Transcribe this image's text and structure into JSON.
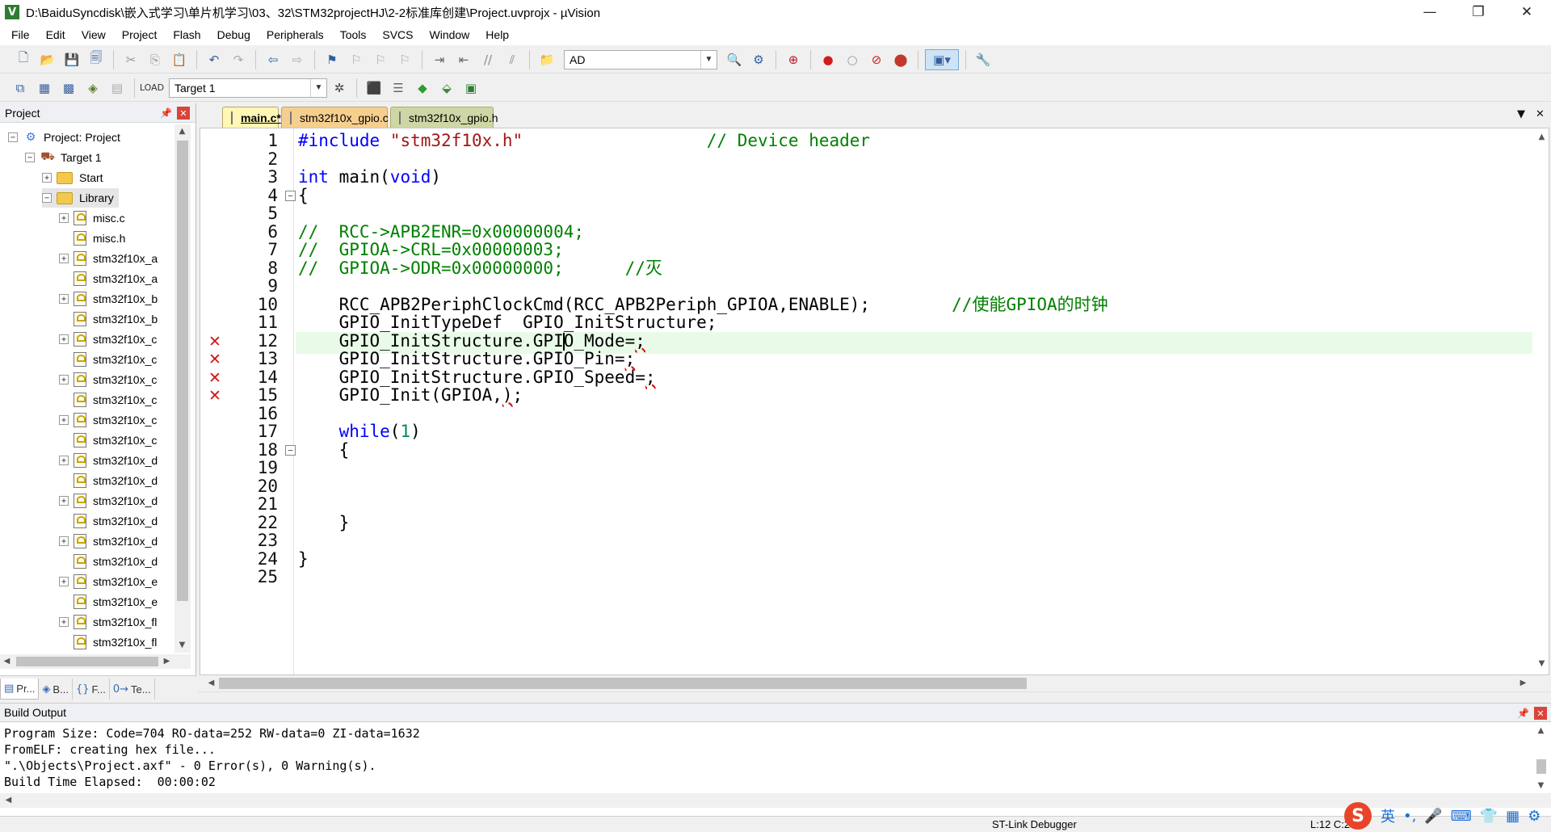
{
  "window": {
    "title": "D:\\BaiduSyncdisk\\嵌入式学习\\单片机学习\\03、32\\STM32projectHJ\\2-2标准库创建\\Project.uvprojx - µVision",
    "app_icon": "V",
    "controls": {
      "minimize": "—",
      "restore": "❐",
      "close": "✕"
    }
  },
  "menu": [
    "File",
    "Edit",
    "View",
    "Project",
    "Flash",
    "Debug",
    "Peripherals",
    "Tools",
    "SVCS",
    "Window",
    "Help"
  ],
  "toolbar1": {
    "find_combo_value": "AD",
    "icons": [
      "new-file-icon",
      "open-icon",
      "save-icon",
      "save-all-icon",
      "cut-icon",
      "copy-icon",
      "paste-icon",
      "undo-icon",
      "redo-icon",
      "nav-back-icon",
      "nav-forward-icon",
      "bookmark-icon",
      "prev-bookmark-icon",
      "next-bookmark-icon",
      "clear-bookmarks-icon",
      "indent-icon",
      "unindent-icon",
      "comment-icon",
      "uncomment-icon",
      "find-in-files-icon",
      "find-icon",
      "incremental-find-icon",
      "debug-start-icon",
      "breakpoint-insert-icon",
      "breakpoint-enable-icon",
      "breakpoint-disable-icon",
      "breakpoint-kill-icon",
      "window-layout-icon",
      "configure-icon"
    ]
  },
  "toolbar2": {
    "target_combo_value": "Target 1",
    "icons": [
      "translate-icon",
      "build-icon",
      "rebuild-icon",
      "batch-build-icon",
      "stop-build-icon",
      "download-icon",
      "target-options-icon",
      "manage-components-icon",
      "select-packs-icon",
      "pack-installer-icon",
      "software-packs-icon"
    ]
  },
  "project_panel": {
    "title": "Project",
    "tree": [
      {
        "label": "Project: Project",
        "level": 0,
        "expander": "−",
        "icon": "project"
      },
      {
        "label": "Target 1",
        "level": 1,
        "expander": "−",
        "icon": "target"
      },
      {
        "label": "Start",
        "level": 2,
        "expander": "+",
        "icon": "folder"
      },
      {
        "label": "Library",
        "level": 2,
        "expander": "−",
        "icon": "folder",
        "selected": true
      },
      {
        "label": "misc.c",
        "level": 3,
        "expander": "+",
        "icon": "file"
      },
      {
        "label": "misc.h",
        "level": 3,
        "expander": "",
        "icon": "file"
      },
      {
        "label": "stm32f10x_a",
        "level": 3,
        "expander": "+",
        "icon": "file"
      },
      {
        "label": "stm32f10x_a",
        "level": 3,
        "expander": "",
        "icon": "file"
      },
      {
        "label": "stm32f10x_b",
        "level": 3,
        "expander": "+",
        "icon": "file"
      },
      {
        "label": "stm32f10x_b",
        "level": 3,
        "expander": "",
        "icon": "file"
      },
      {
        "label": "stm32f10x_c",
        "level": 3,
        "expander": "+",
        "icon": "file"
      },
      {
        "label": "stm32f10x_c",
        "level": 3,
        "expander": "",
        "icon": "file"
      },
      {
        "label": "stm32f10x_c",
        "level": 3,
        "expander": "+",
        "icon": "file"
      },
      {
        "label": "stm32f10x_c",
        "level": 3,
        "expander": "",
        "icon": "file"
      },
      {
        "label": "stm32f10x_c",
        "level": 3,
        "expander": "+",
        "icon": "file"
      },
      {
        "label": "stm32f10x_c",
        "level": 3,
        "expander": "",
        "icon": "file"
      },
      {
        "label": "stm32f10x_d",
        "level": 3,
        "expander": "+",
        "icon": "file"
      },
      {
        "label": "stm32f10x_d",
        "level": 3,
        "expander": "",
        "icon": "file"
      },
      {
        "label": "stm32f10x_d",
        "level": 3,
        "expander": "+",
        "icon": "file"
      },
      {
        "label": "stm32f10x_d",
        "level": 3,
        "expander": "",
        "icon": "file"
      },
      {
        "label": "stm32f10x_d",
        "level": 3,
        "expander": "+",
        "icon": "file"
      },
      {
        "label": "stm32f10x_d",
        "level": 3,
        "expander": "",
        "icon": "file"
      },
      {
        "label": "stm32f10x_e",
        "level": 3,
        "expander": "+",
        "icon": "file"
      },
      {
        "label": "stm32f10x_e",
        "level": 3,
        "expander": "",
        "icon": "file"
      },
      {
        "label": "stm32f10x_fl",
        "level": 3,
        "expander": "+",
        "icon": "file"
      },
      {
        "label": "stm32f10x_fl",
        "level": 3,
        "expander": "",
        "icon": "file"
      }
    ],
    "tabs": [
      {
        "label": "Pr...",
        "icon": "project-tab-icon",
        "glyph": "▤",
        "active": true
      },
      {
        "label": "B...",
        "icon": "books-tab-icon",
        "glyph": "◈",
        "active": false
      },
      {
        "label": "F...",
        "icon": "functions-tab-icon",
        "glyph": "{}",
        "active": false
      },
      {
        "label": "Te...",
        "icon": "templates-tab-icon",
        "glyph": "0→",
        "active": false
      }
    ]
  },
  "editor": {
    "tabs": [
      {
        "label": "main.c*",
        "active": true,
        "bg": "#fff7b3"
      },
      {
        "label": "stm32f10x_gpio.c",
        "active": false,
        "bg": "#f6cf8e"
      },
      {
        "label": "stm32f10x_gpio.h",
        "active": false,
        "bg": "#cfd6a6"
      }
    ],
    "lines": [
      {
        "n": 1,
        "html": "<span class=\"kw\">#include</span> <span class=\"str\">\"stm32f10x.h\"</span>                  <span class=\"cmt\">// Device header</span>"
      },
      {
        "n": 2,
        "html": ""
      },
      {
        "n": 3,
        "html": "<span class=\"kw\">int</span> main(<span class=\"kw\">void</span>)"
      },
      {
        "n": 4,
        "html": "{",
        "fold": "−"
      },
      {
        "n": 5,
        "html": ""
      },
      {
        "n": 6,
        "html": "<span class=\"cmt\">//  RCC-&gt;APB2ENR=0x00000004;</span>"
      },
      {
        "n": 7,
        "html": "<span class=\"cmt\">//  GPIOA-&gt;CRL=0x00000003;</span>"
      },
      {
        "n": 8,
        "html": "<span class=\"cmt\">//  GPIOA-&gt;ODR=0x00000000;      //灭</span>"
      },
      {
        "n": 9,
        "html": ""
      },
      {
        "n": 10,
        "html": "    RCC_APB2PeriphClockCmd(RCC_APB2Periph_GPIOA,ENABLE);        <span class=\"cmt\">//使能GPIOA的时钟</span>"
      },
      {
        "n": 11,
        "html": "    GPIO_InitTypeDef  GPIO_InitStructure;"
      },
      {
        "n": 12,
        "html": "    GPIO_InitStructure.GPI<span class=\"caret\"></span>O_Mode=<span class=\"squig\">;</span>",
        "error": true,
        "current": true
      },
      {
        "n": 13,
        "html": "    GPIO_InitStructure.GPIO_Pin=<span class=\"squig\">;</span>",
        "error": true
      },
      {
        "n": 14,
        "html": "    GPIO_InitStructure.GPIO_Speed=<span class=\"squig\">;</span>",
        "error": true
      },
      {
        "n": 15,
        "html": "    GPIO_Init(GPIOA,<span class=\"squig\">)</span>;",
        "error": true
      },
      {
        "n": 16,
        "html": ""
      },
      {
        "n": 17,
        "html": "    <span class=\"kw\">while</span>(<span class=\"num\">1</span>)"
      },
      {
        "n": 18,
        "html": "    {",
        "fold": "−"
      },
      {
        "n": 19,
        "html": ""
      },
      {
        "n": 20,
        "html": ""
      },
      {
        "n": 21,
        "html": ""
      },
      {
        "n": 22,
        "html": "    }"
      },
      {
        "n": 23,
        "html": ""
      },
      {
        "n": 24,
        "html": "}"
      },
      {
        "n": 25,
        "html": ""
      }
    ]
  },
  "build_output": {
    "title": "Build Output",
    "lines": [
      "Program Size: Code=704 RO-data=252 RW-data=0 ZI-data=1632",
      "FromELF: creating hex file...",
      "\".\\Objects\\Project.axf\" - 0 Error(s), 0 Warning(s).",
      "Build Time Elapsed:  00:00:02"
    ]
  },
  "status": {
    "debugger": "ST-Link Debugger",
    "position": "L:12 C:2"
  },
  "ime": {
    "logo": "S",
    "lang": "英",
    "icons": [
      "punctuation-icon",
      "microphone-icon",
      "keyboard-icon",
      "skin-icon",
      "toolbox-icon",
      "settings-icon"
    ]
  }
}
